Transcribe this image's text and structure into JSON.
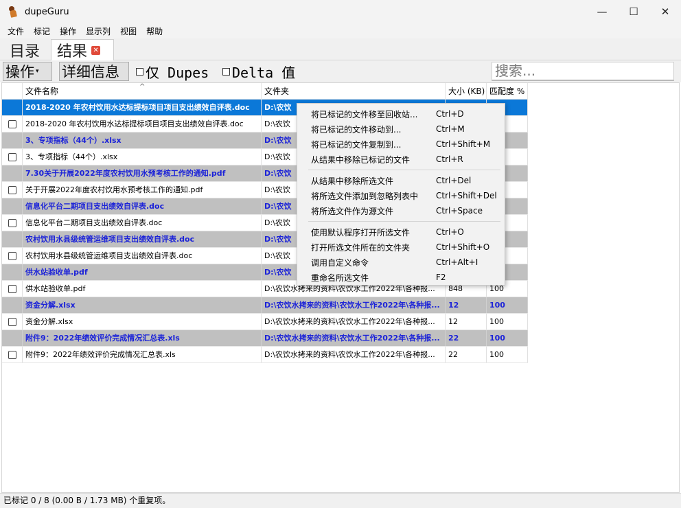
{
  "window": {
    "title": "dupeGuru",
    "minimize": "—",
    "maximize": "☐",
    "close": "✕"
  },
  "menu": [
    "文件",
    "标记",
    "操作",
    "显示列",
    "视图",
    "帮助"
  ],
  "tabs": [
    {
      "label": "目录"
    },
    {
      "label": "结果",
      "close": "✕"
    }
  ],
  "toolbar": {
    "actions_label": "操作",
    "actions_caret": "▾",
    "details_label": "详细信息",
    "dupes_only_label": "仅 Dupes",
    "delta_values_label": "Delta 值",
    "search_placeholder": "搜索..."
  },
  "table": {
    "columns": [
      "",
      "文件名称",
      "文件夹",
      "大小 (KB)",
      "匹配度 %"
    ],
    "sort_indicator": "^",
    "rows": [
      {
        "type": "sel",
        "name": "2018-2020 年农村饮用水达标提标项目项目支出绩效自评表.doc",
        "folder": "D:\\农饮",
        "size": "",
        "match": ""
      },
      {
        "type": "dupe",
        "name": "2018-2020 年农村饮用水达标提标项目项目支出绩效自评表.doc",
        "folder": "D:\\农饮",
        "size": "",
        "match": ""
      },
      {
        "type": "ref",
        "name": "3、专项指标（44个）.xlsx",
        "folder": "D:\\农饮",
        "size": "",
        "match": ""
      },
      {
        "type": "dupe",
        "name": "3、专项指标（44个）.xlsx",
        "folder": "D:\\农饮",
        "size": "",
        "match": ""
      },
      {
        "type": "ref",
        "name": "7.30关于开展2022年度农村饮用水预考核工作的通知.pdf",
        "folder": "D:\\农饮",
        "size": "",
        "match": ""
      },
      {
        "type": "dupe",
        "name": "关于开展2022年度农村饮用水预考核工作的通知.pdf",
        "folder": "D:\\农饮",
        "size": "",
        "match": ""
      },
      {
        "type": "ref",
        "name": "信息化平台二期项目支出绩效自评表.doc",
        "folder": "D:\\农饮",
        "size": "",
        "match": ""
      },
      {
        "type": "dupe",
        "name": "信息化平台二期项目支出绩效自评表.doc",
        "folder": "D:\\农饮",
        "size": "",
        "match": ""
      },
      {
        "type": "ref",
        "name": "农村饮用水县级统管运维项目支出绩效自评表.doc",
        "folder": "D:\\农饮",
        "size": "",
        "match": ""
      },
      {
        "type": "dupe",
        "name": "农村饮用水县级统管运维项目支出绩效自评表.doc",
        "folder": "D:\\农饮",
        "size": "",
        "match": ""
      },
      {
        "type": "ref",
        "name": "供水站验收单.pdf",
        "folder": "D:\\农饮",
        "size": "",
        "match": ""
      },
      {
        "type": "dupe",
        "name": "供水站验收单.pdf",
        "folder": "D:\\农饮水拷来的资料\\农饮水工作2022年\\各种报...",
        "size": "848",
        "match": "100"
      },
      {
        "type": "ref",
        "name": "资金分解.xlsx",
        "folder": "D:\\农饮水拷来的资料\\农饮水工作2022年\\各种报...",
        "size": "12",
        "match": "100"
      },
      {
        "type": "dupe",
        "name": "资金分解.xlsx",
        "folder": "D:\\农饮水拷来的资料\\农饮水工作2022年\\各种报...",
        "size": "12",
        "match": "100"
      },
      {
        "type": "ref",
        "name": "附件9：2022年绩效评价完成情况汇总表.xls",
        "folder": "D:\\农饮水拷来的资料\\农饮水工作2022年\\各种报...",
        "size": "22",
        "match": "100"
      },
      {
        "type": "dupe",
        "name": "附件9：2022年绩效评价完成情况汇总表.xls",
        "folder": "D:\\农饮水拷来的资料\\农饮水工作2022年\\各种报...",
        "size": "22",
        "match": "100"
      }
    ]
  },
  "context_menu": {
    "groups": [
      [
        {
          "label": "将已标记的文件移至回收站...",
          "shortcut": "Ctrl+D"
        },
        {
          "label": "将已标记的文件移动到...",
          "shortcut": "Ctrl+M"
        },
        {
          "label": "将已标记的文件复制到...",
          "shortcut": "Ctrl+Shift+M"
        },
        {
          "label": "从结果中移除已标记的文件",
          "shortcut": "Ctrl+R"
        }
      ],
      [
        {
          "label": "从结果中移除所选文件",
          "shortcut": "Ctrl+Del"
        },
        {
          "label": "将所选文件添加到忽略列表中",
          "shortcut": "Ctrl+Shift+Del"
        },
        {
          "label": "将所选文件作为源文件",
          "shortcut": "Ctrl+Space"
        }
      ],
      [
        {
          "label": "使用默认程序打开所选文件",
          "shortcut": "Ctrl+O"
        },
        {
          "label": "打开所选文件所在的文件夹",
          "shortcut": "Ctrl+Shift+O"
        },
        {
          "label": "调用自定义命令",
          "shortcut": "Ctrl+Alt+I"
        },
        {
          "label": "重命名所选文件",
          "shortcut": "F2"
        }
      ]
    ]
  },
  "status": {
    "text": "已标记 0 / 8 (0.00 B / 1.73 MB) 个重复项。"
  }
}
